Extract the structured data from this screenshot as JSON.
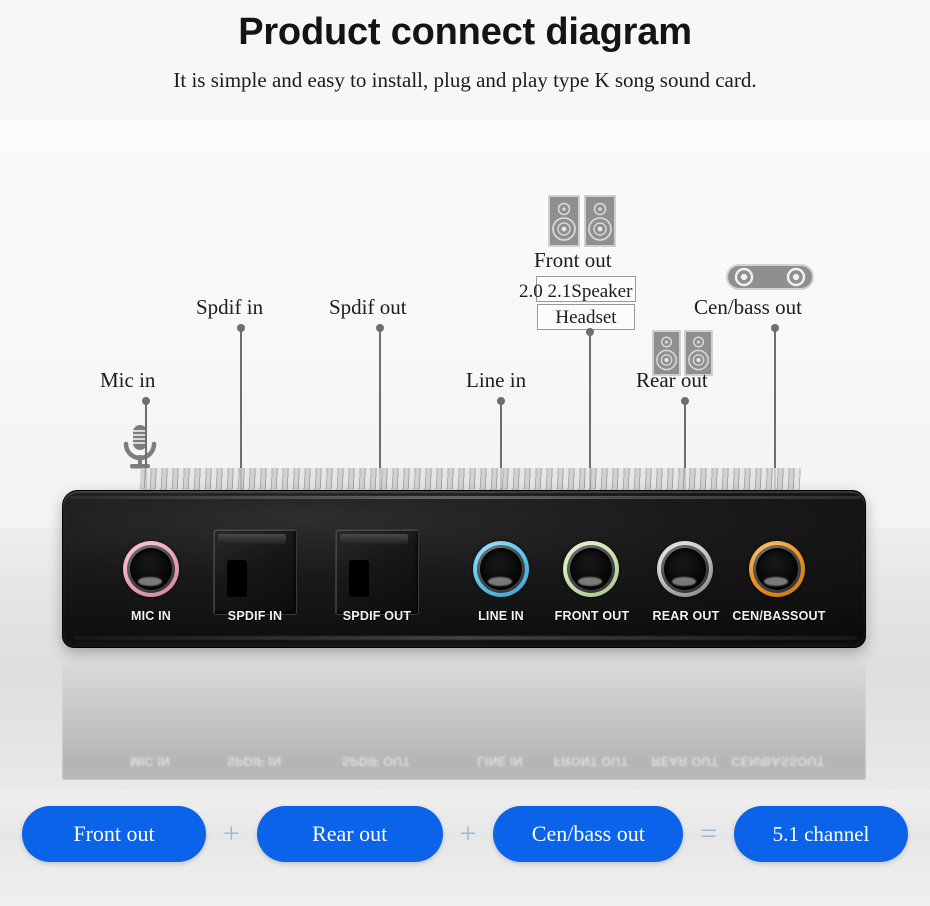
{
  "header": {
    "title": "Product connect diagram",
    "subtitle": "It is simple and easy to install, plug and play type K song sound card."
  },
  "diagram": {
    "callouts": [
      {
        "id": "mic-in",
        "label": "Mic in",
        "icon": "microphone-icon"
      },
      {
        "id": "spdif-in",
        "label": "Spdif in",
        "icon": null
      },
      {
        "id": "spdif-out",
        "label": "Spdif out",
        "icon": null
      },
      {
        "id": "line-in",
        "label": "Line in",
        "icon": null
      },
      {
        "id": "front-out",
        "label": "Front out",
        "icon": "speaker-pair-icon"
      },
      {
        "id": "rear-out",
        "label": "Rear out",
        "icon": "speaker-pair-icon"
      },
      {
        "id": "cen-bass-out",
        "label": "Cen/bass out",
        "icon": "subwoofer-bar-icon"
      }
    ],
    "front_out_options": {
      "speaker": "2.0 2.1Speaker",
      "headset": "Headset"
    }
  },
  "device": {
    "ports": [
      {
        "id": "mic-in",
        "label": "MIC IN",
        "type": "jack",
        "color": "#f0a8c0"
      },
      {
        "id": "spdif-in",
        "label": "SPDIF IN",
        "type": "optical",
        "color": "#1a1a1a"
      },
      {
        "id": "spdif-out",
        "label": "SPDIF OUT",
        "type": "optical",
        "color": "#1a1a1a"
      },
      {
        "id": "line-in",
        "label": "LINE IN",
        "type": "jack",
        "color": "#5ec8f0"
      },
      {
        "id": "front-out",
        "label": "FRONT OUT",
        "type": "jack",
        "color": "#cfe6b4"
      },
      {
        "id": "rear-out",
        "label": "REAR OUT",
        "type": "jack",
        "color": "#d8d8d8"
      },
      {
        "id": "cen-bass-out",
        "label": "CEN/BASSOUT",
        "type": "jack",
        "color": "#f0951e"
      }
    ]
  },
  "formula": {
    "terms": [
      {
        "label": "Front out"
      },
      {
        "label": "Rear out"
      },
      {
        "label": "Cen/bass out"
      },
      {
        "label": "5.1 channel"
      }
    ],
    "plus": "+",
    "equals": "=",
    "accent_color": "#0b63ea"
  }
}
